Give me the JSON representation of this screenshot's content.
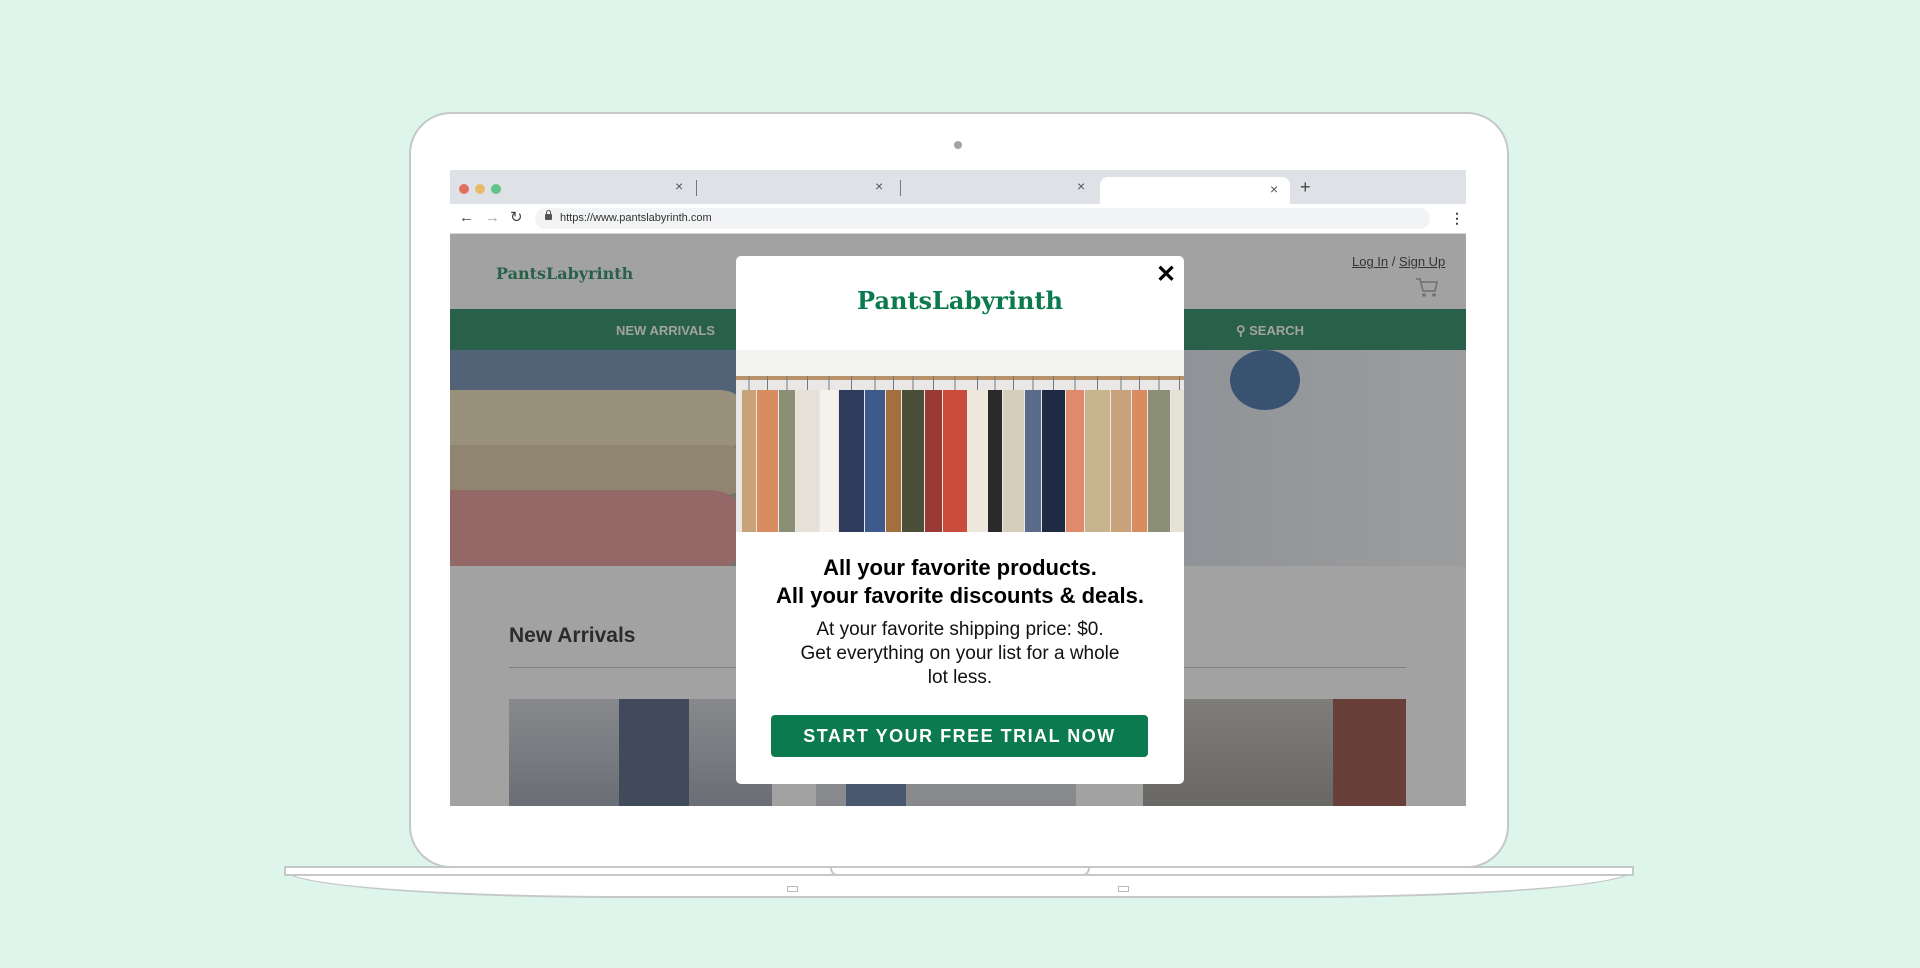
{
  "browser": {
    "url": "https://www.pantslabyrinth.com",
    "tab_close_glyph": "×",
    "new_tab_glyph": "+"
  },
  "site": {
    "logo": "PantsLabyrinth",
    "auth": {
      "login": "Log In",
      "separator": "/",
      "signup": "Sign Up"
    },
    "nav": {
      "new_arrivals": "NEW ARRIVALS",
      "search": "SEARCH"
    },
    "section_title": "New Arrivals"
  },
  "modal": {
    "close_glyph": "✕",
    "logo": "PantsLabyrinth",
    "headline_line1": "All your favorite products.",
    "headline_line2": "All your favorite discounts & deals.",
    "body_line1": "At your favorite shipping price: $0.",
    "body_line2": "Get everything on your list for a whole lot less.",
    "cta": "START YOUR FREE TRIAL NOW"
  },
  "colors": {
    "brand_green": "#0b7a4f",
    "background_mint": "#def5ec"
  }
}
